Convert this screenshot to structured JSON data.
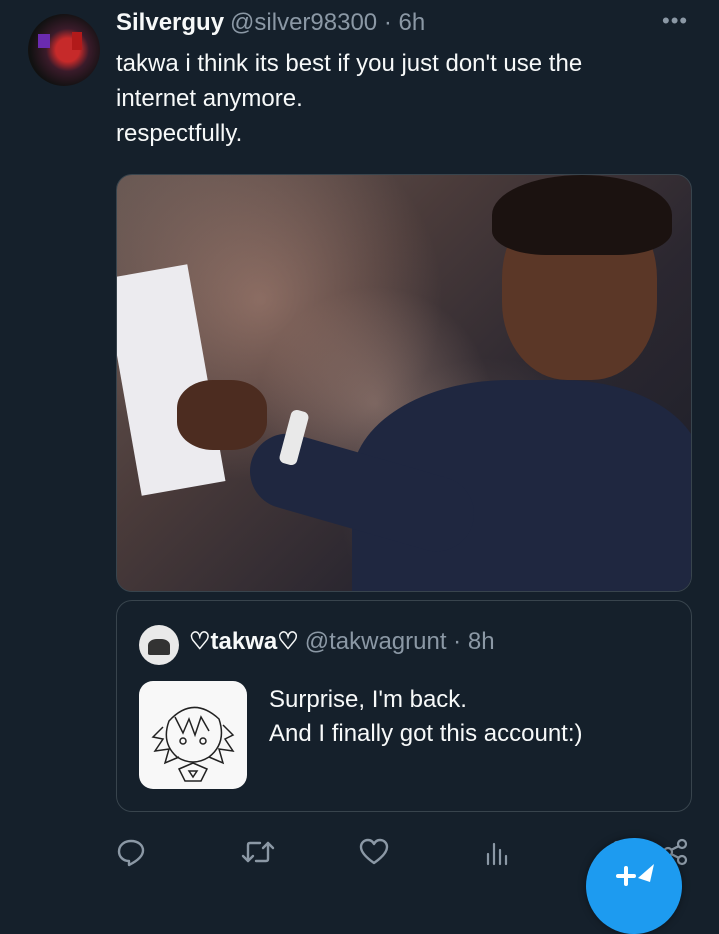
{
  "tweet": {
    "author": {
      "display_name": "Silverguy",
      "handle": "@silver98300",
      "separator": "·",
      "time": "6h"
    },
    "text_lines": [
      "takwa i think its best if you just don't use the",
      "internet anymore.",
      "respectfully."
    ]
  },
  "quoted_tweet": {
    "display_name": "♡takwa♡",
    "handle": "@takwagrunt",
    "separator": "·",
    "time": "8h",
    "text_lines": [
      "Surprise, I'm back.",
      "And I finally got this account:)"
    ]
  },
  "actions": [
    {
      "name": "reply",
      "icon": "reply-icon"
    },
    {
      "name": "retweet",
      "icon": "retweet-icon"
    },
    {
      "name": "like",
      "icon": "heart-icon"
    },
    {
      "name": "views",
      "icon": "analytics-icon"
    },
    {
      "name": "share",
      "icon": "share-icon"
    }
  ],
  "colors": {
    "background": "#15202b",
    "text": "#f7f9f9",
    "muted": "#8b98a5",
    "border": "#38444d",
    "accent": "#1d9bf0"
  }
}
